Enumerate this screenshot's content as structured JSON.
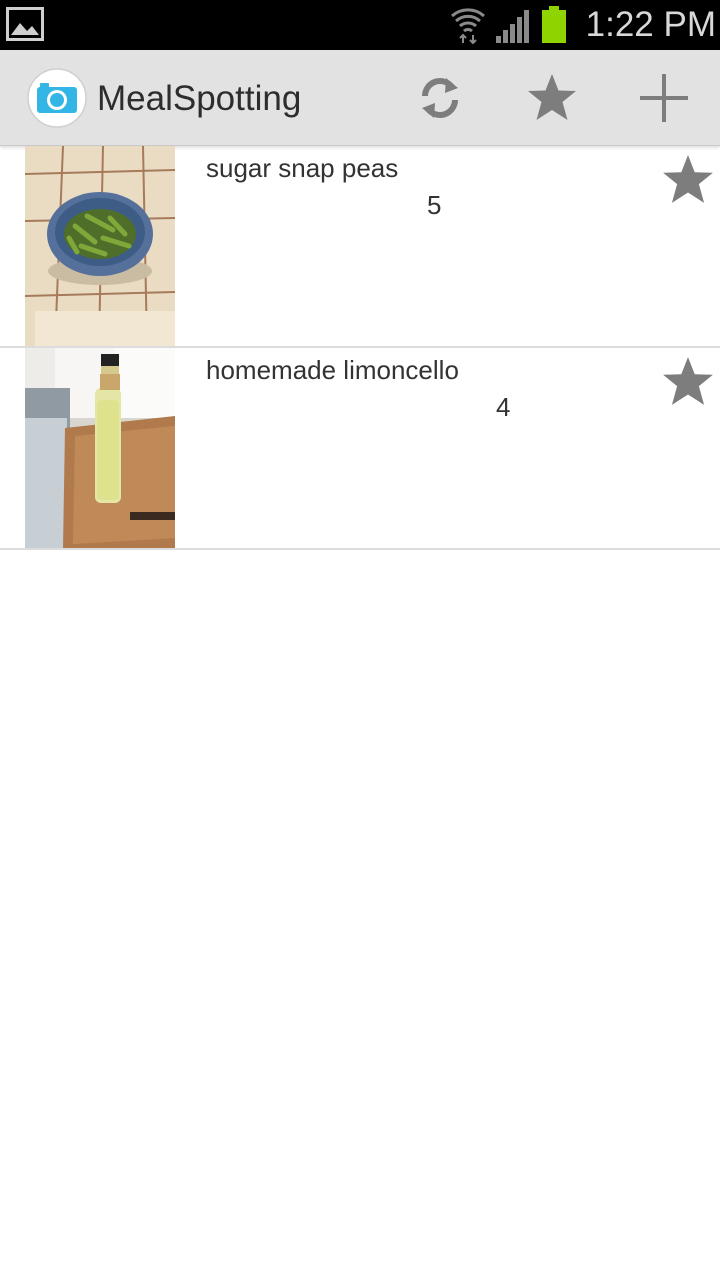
{
  "status_bar": {
    "time": "1:22 PM",
    "icons": [
      "gallery-icon",
      "wifi-icon",
      "signal-icon",
      "battery-icon"
    ],
    "battery_color": "#8fd400"
  },
  "action_bar": {
    "title": "MealSpotting",
    "app_icon": "camera-icon",
    "accent": "#33b5e5",
    "actions": [
      {
        "name": "refresh",
        "icon": "refresh-icon"
      },
      {
        "name": "favorites",
        "icon": "star-icon"
      },
      {
        "name": "add",
        "icon": "plus-icon"
      }
    ]
  },
  "meals": [
    {
      "name": "sugar snap peas",
      "count": "5",
      "photo": "bowl of sugar snap peas"
    },
    {
      "name": "homemade limoncello",
      "count": "4",
      "photo": "bottle of limoncello"
    }
  ]
}
